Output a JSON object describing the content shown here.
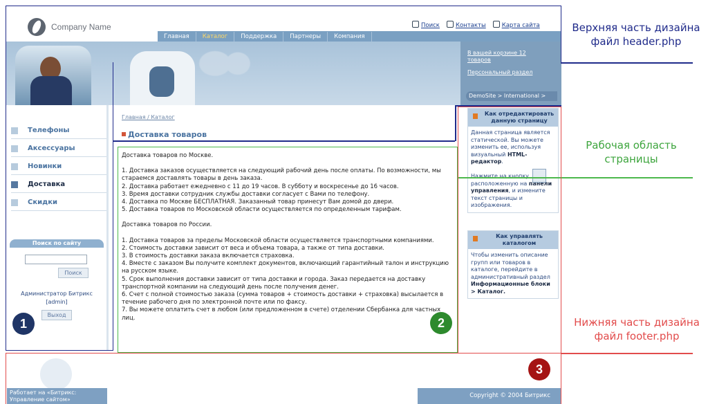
{
  "logo": {
    "name": "Company Name"
  },
  "top_links": {
    "search": "Поиск",
    "contacts": "Контакты",
    "sitemap": "Карта сайта"
  },
  "menu": {
    "items": [
      "Главная",
      "Каталог",
      "Поддержка",
      "Партнеры",
      "Компания"
    ],
    "active": "Каталог"
  },
  "cart_panel": {
    "cart_link": "В вашей корзине 12 товаров",
    "personal": "Персональный раздел",
    "site_selector": "DemoSite > International >"
  },
  "left_nav": {
    "items": [
      "Телефоны",
      "Аксессуары",
      "Новинки",
      "Доставка",
      "Скидки"
    ],
    "active": "Доставка"
  },
  "search": {
    "title": "Поиск по сайту",
    "button": "Поиск"
  },
  "admin": {
    "line1": "Администратор Битрикс",
    "line2": "[admin]",
    "logout": "Выход"
  },
  "breadcrumb": "Главная / Каталог",
  "page_title": "Доставка товаров",
  "content": {
    "section1_title": "Доставка товаров по Москве.",
    "section1": [
      "1. Доставка заказов осуществляется на следующий рабочий день после оплаты. По возможности, мы стараемся доставлять товары в день заказа.",
      "2. Доставка работает ежедневно с 11 до 19 часов. В субботу и воскресенье до 16 часов.",
      "3. Время доставки сотрудник службы доставки согласует с Вами по телефону.",
      "4. Доставка по Москве БЕСПЛАТНАЯ. Заказанный товар принесут Вам домой до двери.",
      "5. Доставка товаров по Московской области осуществляется по определенным тарифам."
    ],
    "section2_title": "Доставка товаров по России.",
    "section2": [
      "1. Доставка товаров за пределы Московской области осуществляется транспортными компаниями.",
      "2. Стоимость доставки зависит от веса и объема товара, а также от типа доставки.",
      "3. В стоимость доставки заказа включается страховка.",
      "4. Вместе с заказом Вы получите комплект документов, включающий гарантийный талон и инструкцию на русском языке.",
      "5. Срок выполнения доставки зависит от типа доставки и города. Заказ передается на доставку транспортной компании на следующий день после получения денег.",
      "6. Счет с полной стоимостью заказа (сумма товаров + стоимость доставки + страховка) высылается в течение рабочего дня по электронной почте или по факсу.",
      "7. Вы можете оплатить счет в любом (или предложенном в счете) отделении Сбербанка для частных лиц."
    ]
  },
  "right_panel1": {
    "title": "Как отредактировать данную страницу",
    "text1": "Данная страница является статической. Вы можете изменить ее, используя визуальный",
    "text1_bold": "HTML-редактор",
    "text2": "Нажмите на кнопку расположенную на",
    "text2_bold": "панели управления",
    "text3": ", и измените текст страницы и изображения."
  },
  "right_panel2": {
    "title": "Как управлять каталогом",
    "text": "Чтобы изменить описание групп или товаров в каталоге, перейдите в административный раздел",
    "text_bold": "Информационные блоки > Каталог."
  },
  "footer": {
    "powered_by": "Работает на «Битрикс: Управление сайтом»",
    "copyright": "Copyright © 2004 Битрикс"
  },
  "annotations": {
    "header_note_line1": "Верхняя часть дизайна",
    "header_note_line2": "файл header.php",
    "work_note_line1": "Рабочая область",
    "work_note_line2": "страницы",
    "footer_note_line1": "Нижняя часть дизайна",
    "footer_note_line2": "файл footer.php",
    "marker1": "1",
    "marker2": "2",
    "marker3": "3"
  },
  "colors": {
    "header_frame": "#1f2a8a",
    "work_frame": "#4cb84c",
    "footer_frame": "#e24b4b",
    "marker1": "#1f3566",
    "marker2": "#2d8a2d",
    "marker3": "#a51414"
  }
}
